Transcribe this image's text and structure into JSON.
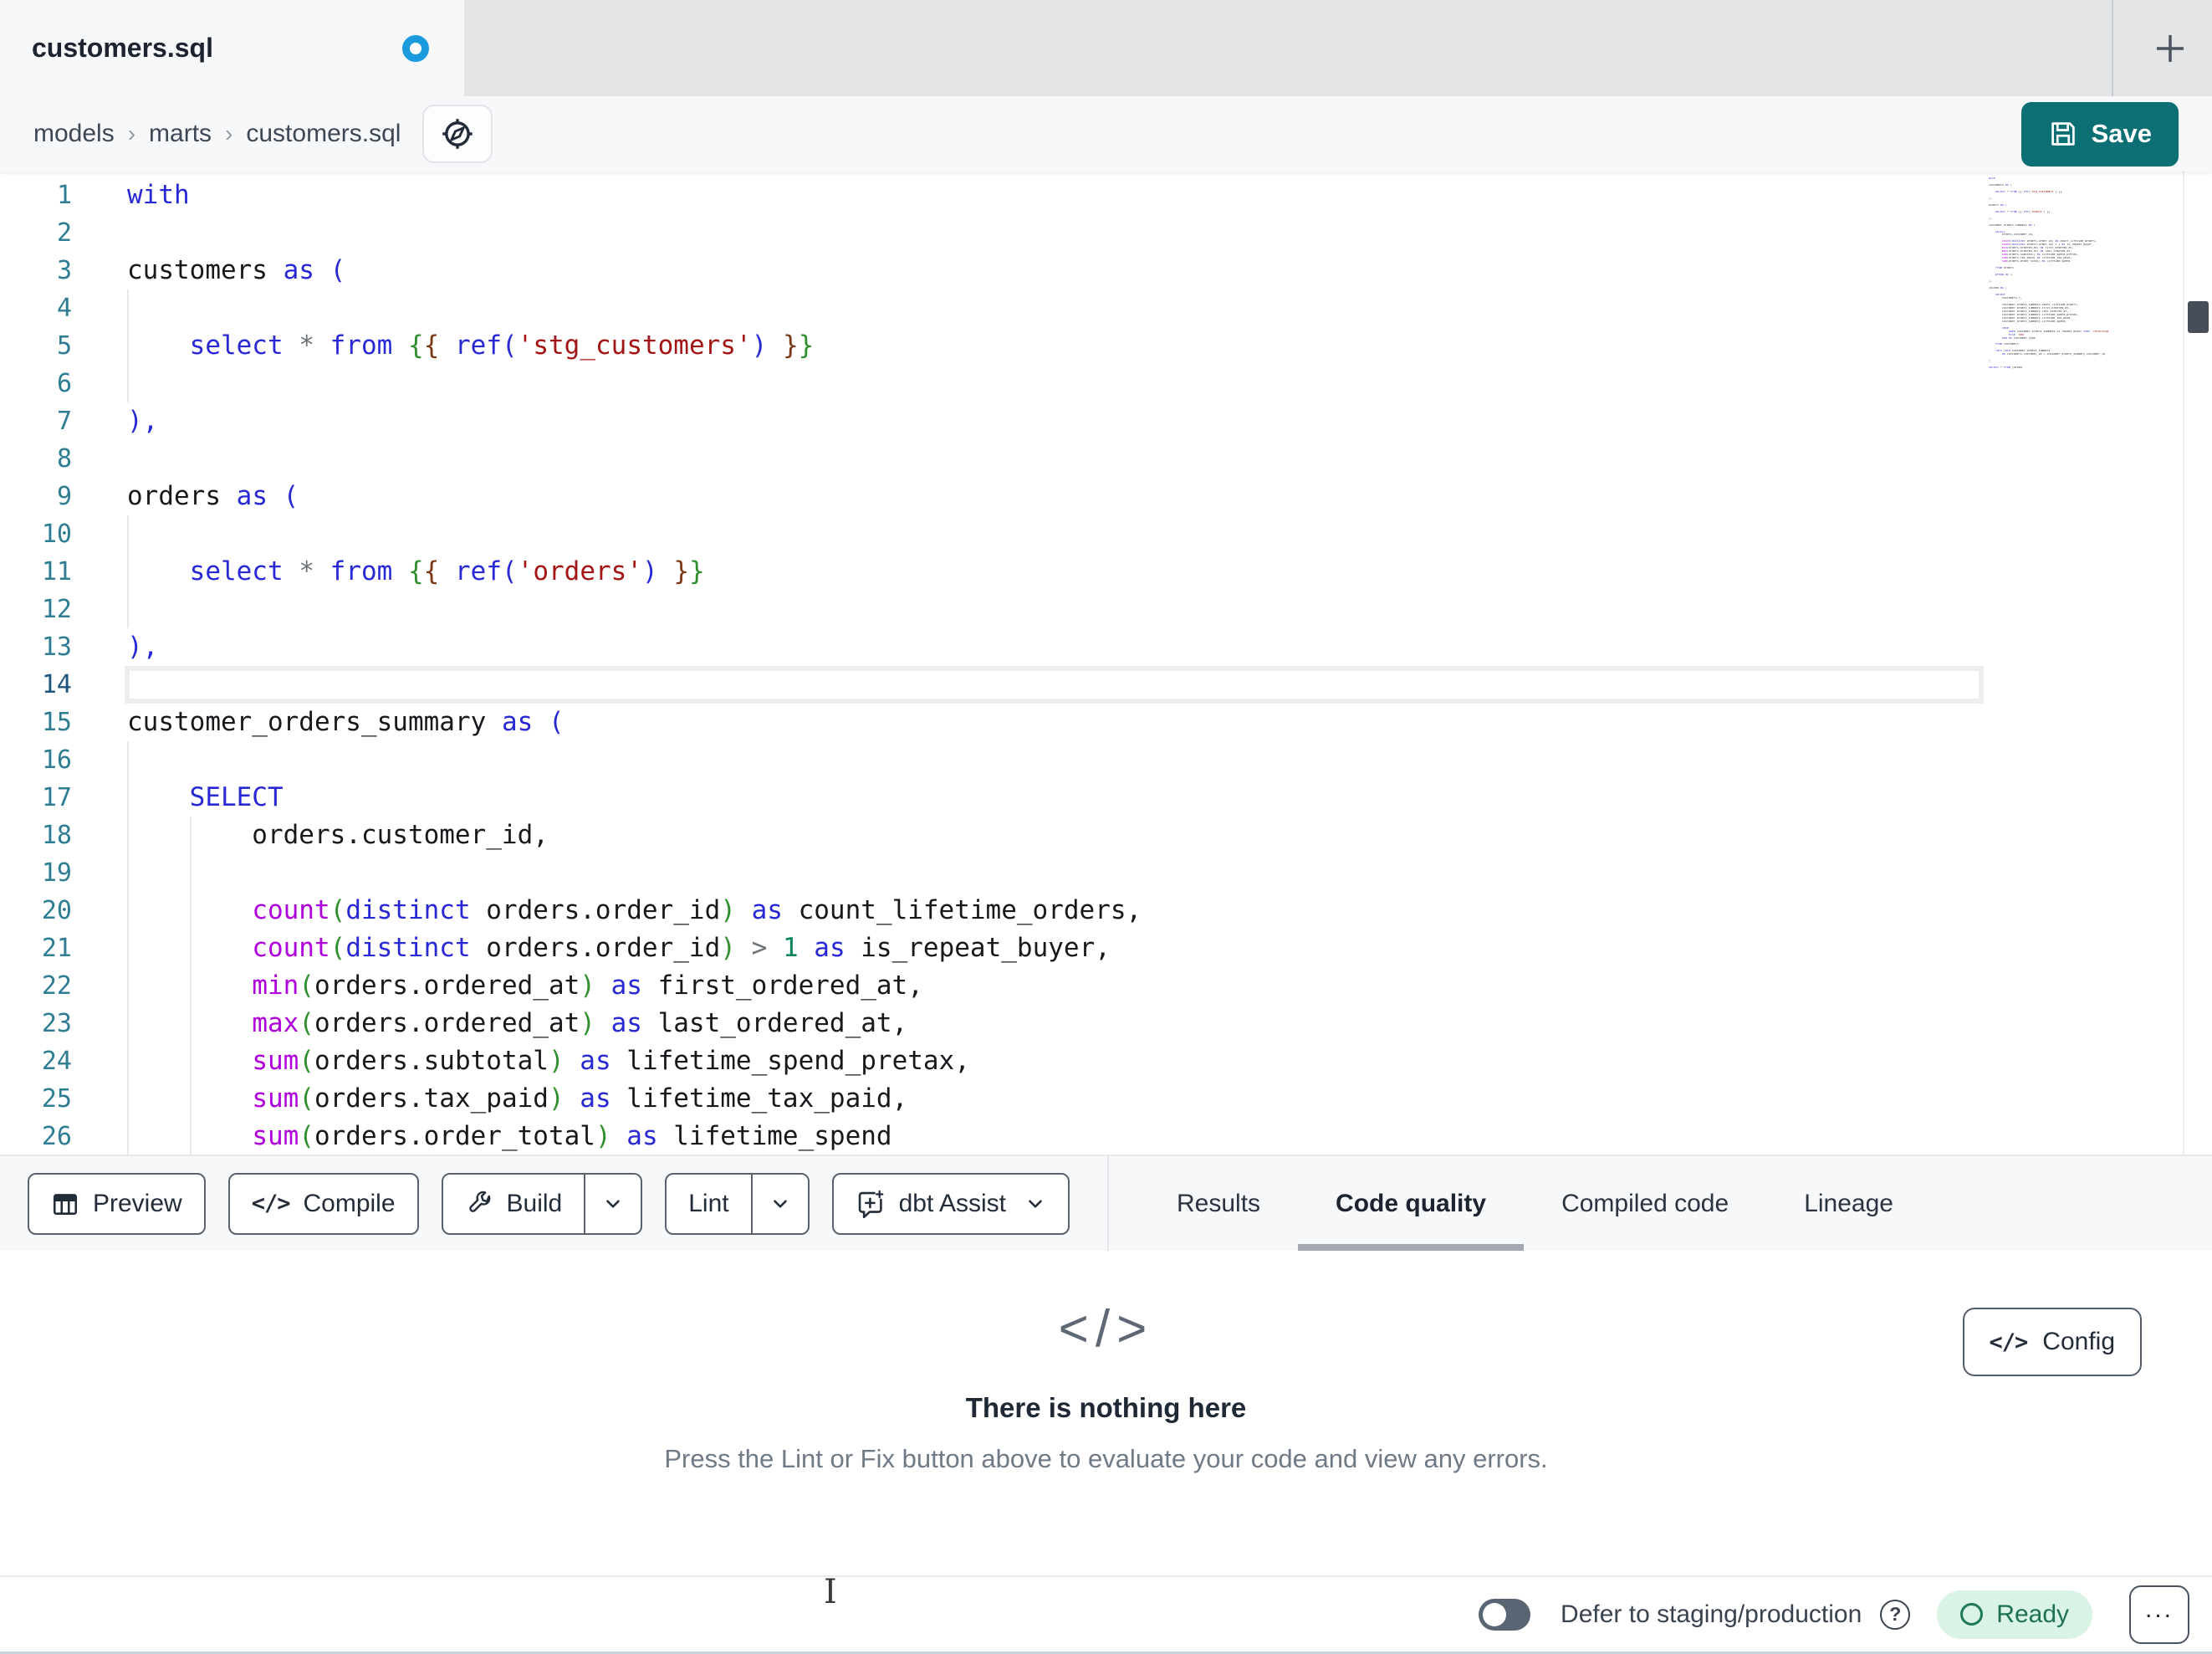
{
  "tabstrip": {
    "tab_title": "customers.sql",
    "dirty_indicator": "unsaved-changes",
    "dot_color": "#1b9ade"
  },
  "breadcrumb": {
    "items": [
      "models",
      "marts",
      "customers.sql"
    ],
    "separator": "›"
  },
  "save": {
    "label": "Save",
    "accent_color": "#0b6f74"
  },
  "editor": {
    "active_line": 14,
    "lines": [
      {
        "n": 1,
        "g": [],
        "t": [
          [
            "kw",
            "with"
          ]
        ]
      },
      {
        "n": 2,
        "g": [],
        "t": []
      },
      {
        "n": 3,
        "g": [],
        "t": [
          [
            "id",
            "customers "
          ],
          [
            "kw",
            "as"
          ],
          [
            "id",
            " "
          ],
          [
            "pb",
            "("
          ]
        ]
      },
      {
        "n": 4,
        "g": [
          0
        ],
        "t": []
      },
      {
        "n": 5,
        "g": [
          0
        ],
        "t": [
          [
            "id",
            "    "
          ],
          [
            "kw",
            "select"
          ],
          [
            "id",
            " "
          ],
          [
            "op",
            "*"
          ],
          [
            "id",
            " "
          ],
          [
            "kw",
            "from"
          ],
          [
            "id",
            " "
          ],
          [
            "pg",
            "{"
          ],
          [
            "pm",
            "{"
          ],
          [
            "id",
            " "
          ],
          [
            "kw",
            "ref"
          ],
          [
            "pb",
            "("
          ],
          [
            "str",
            "'stg_customers'"
          ],
          [
            "pb",
            ")"
          ],
          [
            "id",
            " "
          ],
          [
            "pm",
            "}"
          ],
          [
            "pg",
            "}"
          ]
        ]
      },
      {
        "n": 6,
        "g": [
          0
        ],
        "t": []
      },
      {
        "n": 7,
        "g": [],
        "t": [
          [
            "pb",
            "),"
          ]
        ]
      },
      {
        "n": 8,
        "g": [],
        "t": []
      },
      {
        "n": 9,
        "g": [],
        "t": [
          [
            "id",
            "orders "
          ],
          [
            "kw",
            "as"
          ],
          [
            "id",
            " "
          ],
          [
            "pb",
            "("
          ]
        ]
      },
      {
        "n": 10,
        "g": [
          0
        ],
        "t": []
      },
      {
        "n": 11,
        "g": [
          0
        ],
        "t": [
          [
            "id",
            "    "
          ],
          [
            "kw",
            "select"
          ],
          [
            "id",
            " "
          ],
          [
            "op",
            "*"
          ],
          [
            "id",
            " "
          ],
          [
            "kw",
            "from"
          ],
          [
            "id",
            " "
          ],
          [
            "pg",
            "{"
          ],
          [
            "pm",
            "{"
          ],
          [
            "id",
            " "
          ],
          [
            "kw",
            "ref"
          ],
          [
            "pb",
            "("
          ],
          [
            "str",
            "'orders'"
          ],
          [
            "pb",
            ")"
          ],
          [
            "id",
            " "
          ],
          [
            "pm",
            "}"
          ],
          [
            "pg",
            "}"
          ]
        ]
      },
      {
        "n": 12,
        "g": [
          0
        ],
        "t": []
      },
      {
        "n": 13,
        "g": [],
        "t": [
          [
            "pb",
            "),"
          ]
        ]
      },
      {
        "n": 14,
        "g": [],
        "t": []
      },
      {
        "n": 15,
        "g": [],
        "t": [
          [
            "id",
            "customer_orders_summary "
          ],
          [
            "kw",
            "as"
          ],
          [
            "id",
            " "
          ],
          [
            "pb",
            "("
          ]
        ]
      },
      {
        "n": 16,
        "g": [
          0
        ],
        "t": []
      },
      {
        "n": 17,
        "g": [
          0
        ],
        "t": [
          [
            "id",
            "    "
          ],
          [
            "kw",
            "SELECT"
          ]
        ]
      },
      {
        "n": 18,
        "g": [
          0,
          4
        ],
        "t": [
          [
            "id",
            "        orders.customer_id,"
          ]
        ]
      },
      {
        "n": 19,
        "g": [
          0,
          4
        ],
        "t": []
      },
      {
        "n": 20,
        "g": [
          0,
          4
        ],
        "t": [
          [
            "id",
            "        "
          ],
          [
            "fn",
            "count"
          ],
          [
            "pg",
            "("
          ],
          [
            "kw",
            "distinct"
          ],
          [
            "id",
            " orders.order_id"
          ],
          [
            "pg",
            ")"
          ],
          [
            "id",
            " "
          ],
          [
            "kw",
            "as"
          ],
          [
            "id",
            " count_lifetime_orders,"
          ]
        ]
      },
      {
        "n": 21,
        "g": [
          0,
          4
        ],
        "t": [
          [
            "id",
            "        "
          ],
          [
            "fn",
            "count"
          ],
          [
            "pg",
            "("
          ],
          [
            "kw",
            "distinct"
          ],
          [
            "id",
            " orders.order_id"
          ],
          [
            "pg",
            ")"
          ],
          [
            "id",
            " "
          ],
          [
            "op",
            ">"
          ],
          [
            "id",
            " "
          ],
          [
            "num",
            "1"
          ],
          [
            "id",
            " "
          ],
          [
            "kw",
            "as"
          ],
          [
            "id",
            " is_repeat_buyer,"
          ]
        ]
      },
      {
        "n": 22,
        "g": [
          0,
          4
        ],
        "t": [
          [
            "id",
            "        "
          ],
          [
            "fn",
            "min"
          ],
          [
            "pg",
            "("
          ],
          [
            "id",
            "orders.ordered_at"
          ],
          [
            "pg",
            ")"
          ],
          [
            "id",
            " "
          ],
          [
            "kw",
            "as"
          ],
          [
            "id",
            " first_ordered_at,"
          ]
        ]
      },
      {
        "n": 23,
        "g": [
          0,
          4
        ],
        "t": [
          [
            "id",
            "        "
          ],
          [
            "fn",
            "max"
          ],
          [
            "pg",
            "("
          ],
          [
            "id",
            "orders.ordered_at"
          ],
          [
            "pg",
            ")"
          ],
          [
            "id",
            " "
          ],
          [
            "kw",
            "as"
          ],
          [
            "id",
            " last_ordered_at,"
          ]
        ]
      },
      {
        "n": 24,
        "g": [
          0,
          4
        ],
        "t": [
          [
            "id",
            "        "
          ],
          [
            "fn",
            "sum"
          ],
          [
            "pg",
            "("
          ],
          [
            "id",
            "orders.subtotal"
          ],
          [
            "pg",
            ")"
          ],
          [
            "id",
            " "
          ],
          [
            "kw",
            "as"
          ],
          [
            "id",
            " lifetime_spend_pretax,"
          ]
        ]
      },
      {
        "n": 25,
        "g": [
          0,
          4
        ],
        "t": [
          [
            "id",
            "        "
          ],
          [
            "fn",
            "sum"
          ],
          [
            "pg",
            "("
          ],
          [
            "id",
            "orders.tax_paid"
          ],
          [
            "pg",
            ")"
          ],
          [
            "id",
            " "
          ],
          [
            "kw",
            "as"
          ],
          [
            "id",
            " lifetime_tax_paid,"
          ]
        ]
      },
      {
        "n": 26,
        "g": [
          0,
          4
        ],
        "t": [
          [
            "id",
            "        "
          ],
          [
            "fn",
            "sum"
          ],
          [
            "pg",
            "("
          ],
          [
            "id",
            "orders.order_total"
          ],
          [
            "pg",
            ")"
          ],
          [
            "id",
            " "
          ],
          [
            "kw",
            "as"
          ],
          [
            "id",
            " lifetime_spend"
          ]
        ]
      }
    ],
    "minimap_lines": [
      "with",
      "",
      "customers as (",
      "",
      "    select * from {{ ref('stg_customers') }}",
      "",
      "),",
      "",
      "orders as (",
      "",
      "    select * from {{ ref('orders') }}",
      "",
      "),",
      "",
      "customer_orders_summary as (",
      "",
      "    SELECT",
      "        orders.customer_id,",
      "",
      "        count(distinct orders.order_id) as count_lifetime_orders,",
      "        count(distinct orders.order_id) > 1 as is_repeat_buyer,",
      "        min(orders.ordered_at) as first_ordered_at,",
      "        max(orders.ordered_at) as last_ordered_at,",
      "        sum(orders.subtotal) as lifetime_spend_pretax,",
      "        sum(orders.tax_paid) as lifetime_tax_paid,",
      "        sum(orders.order_total) as lifetime_spend",
      "",
      "    from orders",
      "",
      "    group by 1",
      "",
      "),",
      "",
      "joined as (",
      "",
      "    select",
      "        customers.*,",
      "",
      "        customer_orders_summary.count_lifetime_orders,",
      "        customer_orders_summary.first_ordered_at,",
      "        customer_orders_summary.last_ordered_at,",
      "        customer_orders_summary.lifetime_spend_pretax,",
      "        customer_orders_summary.lifetime_tax_paid,",
      "        customer_orders_summary.lifetime_spend,",
      "",
      "        case",
      "            when customer_orders_summary.is_repeat_buyer then 'returning'",
      "            else 'new'",
      "        end as customer_type",
      "",
      "    from customers",
      "",
      "    left join customer_orders_summary",
      "        on customers.customer_id = customer_orders_summary.customer_id",
      "",
      ")",
      "",
      "select * from joined"
    ],
    "syntax_colors": {
      "keyword": "#2828d5",
      "function": "#af00db",
      "string": "#a31515",
      "number": "#098658",
      "line_number": "#2e7d93"
    }
  },
  "toolbar": {
    "preview_label": "Preview",
    "compile_label": "Compile",
    "compile_icon_glyph": "</>",
    "build_label": "Build",
    "lint_label": "Lint",
    "assist_label": "dbt Assist"
  },
  "panel_tabs": {
    "items": [
      {
        "label": "Results",
        "active": false
      },
      {
        "label": "Code quality",
        "active": true
      },
      {
        "label": "Compiled code",
        "active": false
      },
      {
        "label": "Lineage",
        "active": false
      }
    ]
  },
  "results": {
    "empty_icon": "</>",
    "title": "There is nothing here",
    "description": "Press the Lint or Fix button above to evaluate your code and view any errors.",
    "config_label": "Config",
    "config_icon_glyph": "</>"
  },
  "statusbar": {
    "defer_label": "Defer to staging/production",
    "ready_label": "Ready",
    "ready_bg": "#d9f3e5",
    "ready_fg": "#1d7350"
  }
}
